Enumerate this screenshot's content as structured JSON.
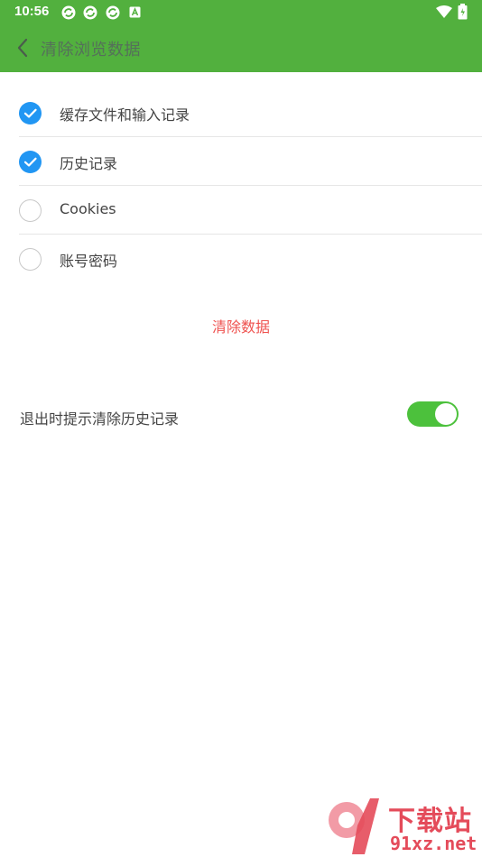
{
  "status_bar": {
    "time": "10:56",
    "icons": [
      "sync-icon",
      "sync-icon",
      "sync-icon",
      "a-icon",
      "wifi-icon",
      "battery-icon"
    ]
  },
  "toolbar": {
    "back_icon": "chevron-left-icon",
    "title": "清除浏览数据"
  },
  "options": [
    {
      "label": "缓存文件和输入记录",
      "checked": true
    },
    {
      "label": "历史记录",
      "checked": true
    },
    {
      "label": "Cookies",
      "checked": false
    },
    {
      "label": "账号密码",
      "checked": false
    }
  ],
  "clear_button": {
    "label": "清除数据"
  },
  "exit_setting": {
    "label": "退出时提示清除历史记录",
    "enabled": true
  },
  "watermark": {
    "text": "下载站",
    "url": "91xz.net"
  },
  "colors": {
    "header": "#52b03e",
    "checkbox_checked": "#2196f3",
    "clear_button_text": "#ef5350",
    "toggle_on": "#4cc13c"
  }
}
